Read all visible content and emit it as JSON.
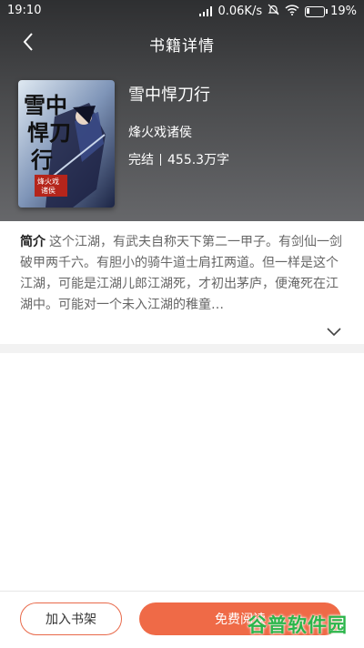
{
  "status_bar": {
    "time": "19:10",
    "network_speed": "0.06K/s",
    "battery": "19%",
    "battery_level": 0.19
  },
  "navbar": {
    "title": "书籍详情",
    "back_icon": "chevron-left-icon"
  },
  "book": {
    "title": "雪中悍刀行",
    "author": "烽火戏诸侯",
    "status": "完结",
    "word_count": "455.3万字",
    "cover_title": "雪中悍刀行",
    "cover_author": "烽火戏诸侯"
  },
  "intro": {
    "label": "简介",
    "text": "这个江湖，有武夫自称天下第二一甲子。有剑仙一剑破甲两千六。有胆小的骑牛道士肩扛两道。但一样是这个江湖，可能是江湖儿郎江湖死，才初出茅庐，便淹死在江湖中。可能对一个未入江湖的稚童…",
    "expand_icon": "chevron-down-icon"
  },
  "actions": {
    "add_to_shelf": "加入书架",
    "free_read": "免费阅读"
  },
  "watermark": "谷普软件园",
  "colors": {
    "accent": "#ef6a47",
    "header_dark": "#2e2f31",
    "watermark": "#2bb54a"
  }
}
